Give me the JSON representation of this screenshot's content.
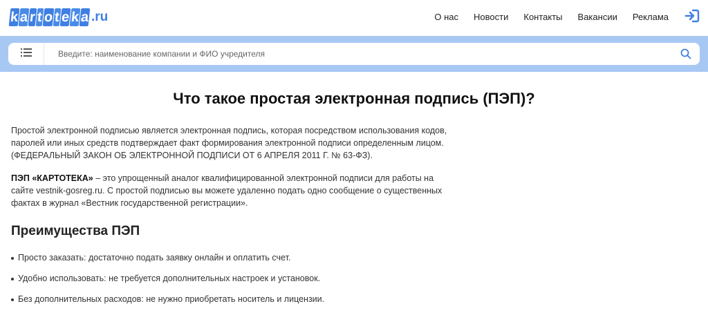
{
  "header": {
    "logo_main": "kartoteka",
    "logo_suffix": ".ru",
    "nav": [
      "О нас",
      "Новости",
      "Контакты",
      "Вакансии",
      "Реклама"
    ]
  },
  "search": {
    "placeholder": "Введите: наименование компании и ФИО учредителя"
  },
  "content": {
    "title": "Что такое простая электронная подпись (ПЭП)?",
    "paragraph1": [
      "Простой электронной подписью является электронная подпись, которая посредством использования кодов,",
      "паролей или иных средств подтверждает факт формирования электронной подписи определенным лицом.",
      "(ФЕДЕРАЛЬНЫЙ ЗАКОН ОБ ЭЛЕКТРОННОЙ ПОДПИСИ ОТ 6 АПРЕЛЯ 2011 Г. № 63-ФЗ)."
    ],
    "paragraph2_bold": "ПЭП «КАРТОТЕКА»",
    "paragraph2": [
      " – это упрощенный аналог квалифицированной электронной подписи для работы на",
      "сайте vestnik-gosreg.ru. С простой подписью вы можете удаленно подать одно сообщение о существенных",
      "фактах в журнал «Вестник государственной регистрации»."
    ],
    "subheading": "Преимущества ПЭП",
    "bullets": [
      "Просто заказать: достаточно подать заявку онлайн и оплатить счет.",
      "Удобно использовать: не требуется дополнительных настроек и установок.",
      "Без дополнительных расходов: не нужно приобретать носитель и лицензии."
    ]
  },
  "colors": {
    "brand": "#3f7fe2",
    "search_band": "#a8c8f4"
  },
  "icons": [
    "menu-icon",
    "search-icon",
    "login-icon"
  ]
}
